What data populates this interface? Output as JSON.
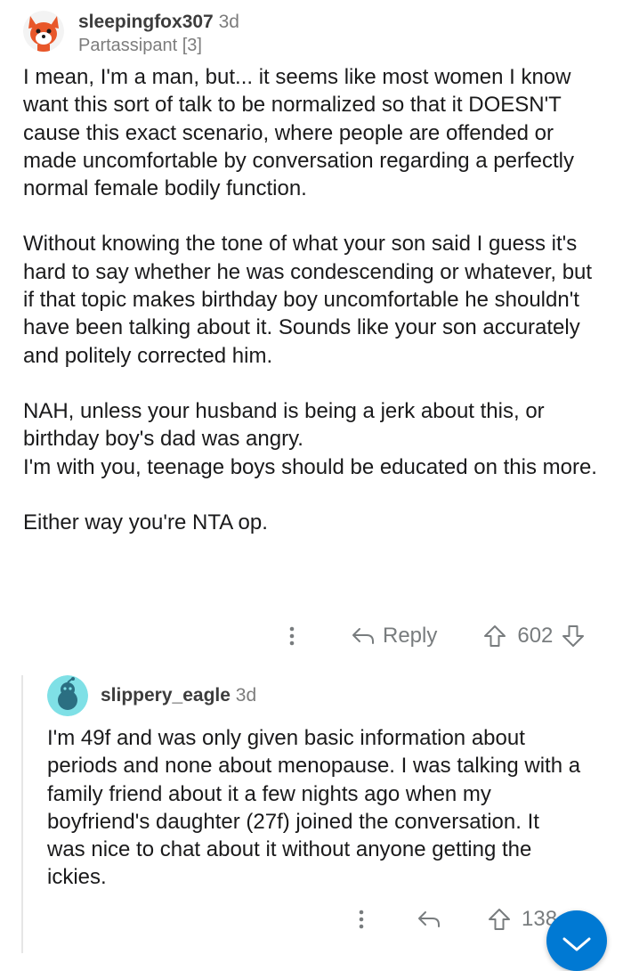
{
  "comment1": {
    "username": "sleepingfox307",
    "time": "3d",
    "flair": "Partassipant [3]",
    "paragraphs": [
      "I mean, I'm a man, but... it seems like most women I know want this sort of talk to be normalized so that it DOESN'T cause this exact scenario, where people are offended or made uncomfortable by conversation regarding a perfectly normal female bodily function.",
      "Without knowing the tone of what your son said I guess it's hard to say whether he was condescending or whatever, but if that topic makes birthday boy uncomfortable he shouldn't have been talking about it. Sounds like your son accurately and politely corrected him.",
      "NAH, unless your husband is being a jerk about this, or birthday boy's dad was angry.",
      "I'm with you, teenage boys should be educated on this more.",
      "Either way you're NTA op."
    ],
    "reply_label": "Reply",
    "votes": "602"
  },
  "comment2": {
    "username": "slippery_eagle",
    "time": "3d",
    "text": "I'm 49f and was only given basic information about periods and none about menopause. I was talking with a family friend about it a few nights ago when my boyfriend's daughter (27f) joined the conversation. It was nice to chat about it without anyone getting the ickies.",
    "votes": "138"
  },
  "icons": {
    "more": "more-vertical-icon",
    "reply": "reply-arrow-icon",
    "upvote": "upvote-icon",
    "downvote": "downvote-icon",
    "scroll": "chevron-down-icon"
  },
  "colors": {
    "text": "#1a1a1b",
    "meta": "#7c7c7c",
    "action": "#787c7e",
    "accent_blue": "#0079d3",
    "thread_line": "#e6e6e6"
  }
}
